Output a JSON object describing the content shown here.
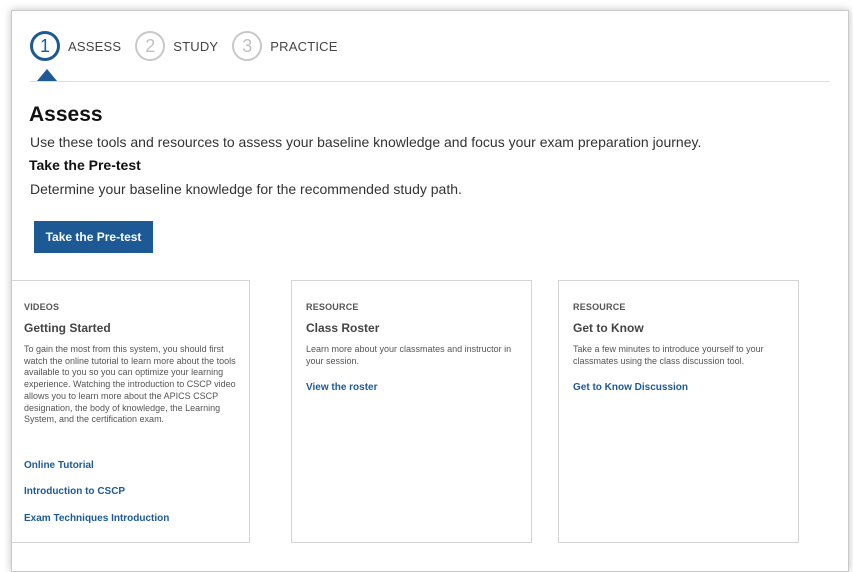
{
  "stepper": {
    "steps": [
      {
        "number": "1",
        "label": "ASSESS"
      },
      {
        "number": "2",
        "label": "STUDY"
      },
      {
        "number": "3",
        "label": "PRACTICE"
      }
    ],
    "active_step": 1
  },
  "main": {
    "title": "Assess",
    "intro": "Use these tools and resources to assess your baseline knowledge and focus your exam preparation journey.",
    "pretest_heading": "Take the Pre-test",
    "pretest_desc": "Determine your baseline knowledge for the recommended study path.",
    "pretest_button": "Take the Pre-test"
  },
  "cards": [
    {
      "eyebrow": "VIDEOS",
      "title": "Getting Started",
      "description": "To gain the most from this system, you should first watch the online tutorial to learn more about the tools available to you so you can optimize your learning experience. Watching the introduction to CSCP video allows you to learn more about the APICS CSCP designation, the body of knowledge, the Learning System, and the certification exam.",
      "links": [
        "Online Tutorial",
        "Introduction to CSCP",
        "Exam Techniques Introduction"
      ]
    },
    {
      "eyebrow": "RESOURCE",
      "title": "Class Roster",
      "description": "Learn more about your classmates and instructor in your session.",
      "links": [
        "View the roster"
      ]
    },
    {
      "eyebrow": "RESOURCE",
      "title": "Get to Know",
      "description": "Take a few minutes to introduce yourself to your classmates using the class discussion tool.",
      "links": [
        "Get to Know Discussion"
      ]
    }
  ],
  "colors": {
    "accent": "#1d5a95",
    "muted_step": "#c8c8c8"
  }
}
